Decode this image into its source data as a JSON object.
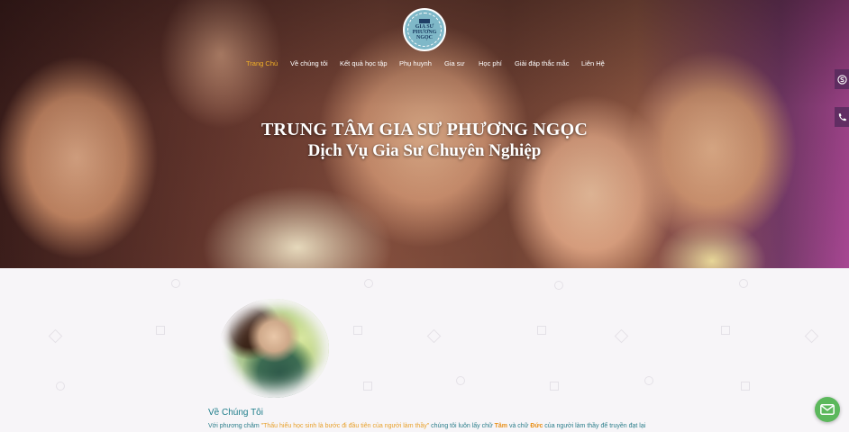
{
  "logo": {
    "text_top": "GIA SƯ",
    "text_bottom": "PHƯƠNG NGỌC"
  },
  "nav": {
    "items": [
      {
        "label": "Trang Chủ",
        "active": true
      },
      {
        "label": "Về chúng tôi"
      },
      {
        "label": "Kết quả học tập"
      },
      {
        "label": "Phụ huynh"
      },
      {
        "label": "Gia sư"
      },
      {
        "label": "Học phí"
      },
      {
        "label": "Giải đáp thắc mắc"
      },
      {
        "label": "Liên Hệ"
      }
    ]
  },
  "hero": {
    "title_line1": "TRUNG TÂM GIA SƯ PHƯƠNG NGỌC",
    "title_line2": "Dịch Vụ Gia Sư Chuyên Nghiệp"
  },
  "side_buttons": [
    {
      "icon": "skype-icon"
    },
    {
      "icon": "phone-icon"
    }
  ],
  "about": {
    "heading": "Về Chúng Tôi",
    "text_prefix": "Với phương châm ",
    "text_quote": "\"Thấu hiểu học sinh là bước đi đầu tiên của người làm thầy\"",
    "text_mid1": " chúng tôi luôn lấy chữ ",
    "text_word1": "Tâm",
    "text_mid2": " và chữ ",
    "text_word2": "Đức",
    "text_suffix": " của người làm thầy để truyền đạt lại"
  },
  "floating": {
    "mail_icon": "mail-icon"
  },
  "colors": {
    "accent_nav_active": "#f5b225",
    "about_text": "#1e7d8a",
    "highlight": "#e8901a",
    "mail_button": "#5cb85c"
  }
}
